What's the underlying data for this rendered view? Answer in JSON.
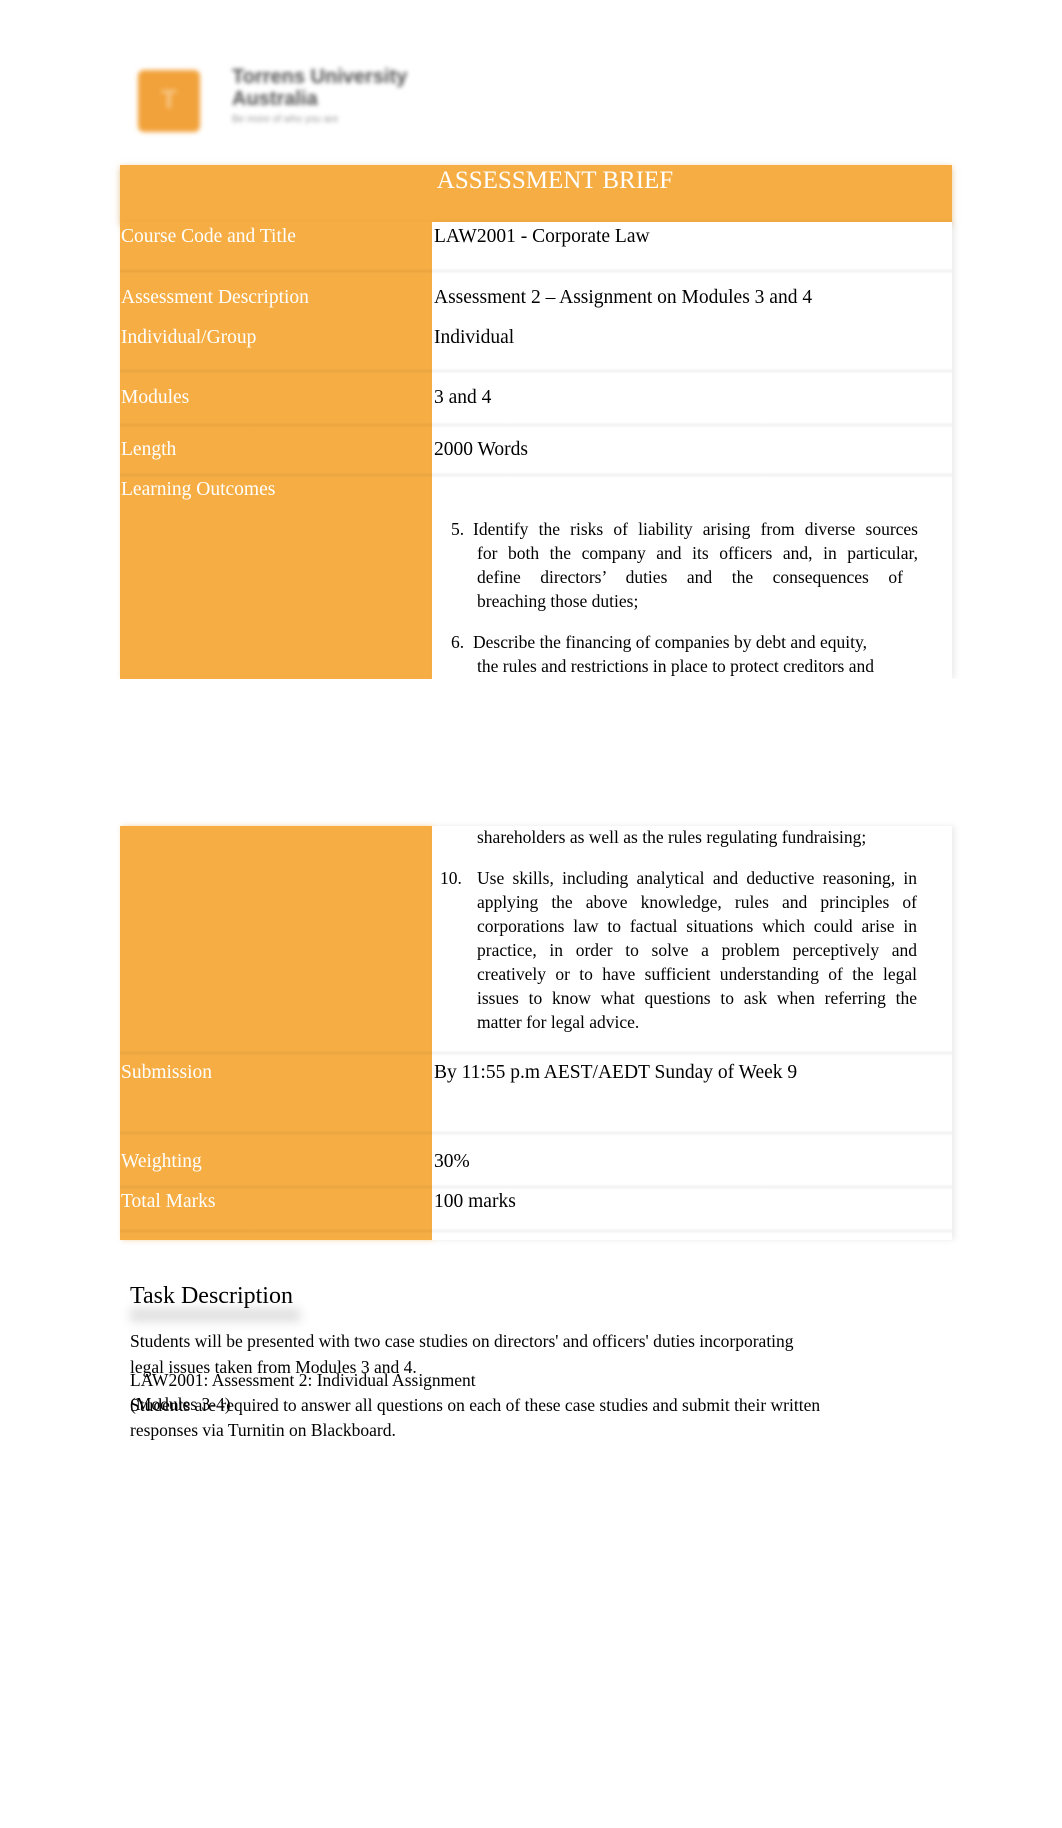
{
  "logo": {
    "name_line1": "Torrens University",
    "name_line2": "Australia",
    "tagline": "Be more of who you are",
    "mark_letter": "T"
  },
  "brief": {
    "title": "ASSESSMENT BRIEF",
    "accent_color": "#f6ae44",
    "rows": [
      {
        "label": "Course Code and Title",
        "value": "LAW2001 - Corporate Law"
      },
      {
        "label": "Assessment Description",
        "value": "Assessment 2 – Assignment on Modules 3 and 4"
      },
      {
        "label": "Individual/Group",
        "value": "Individual"
      },
      {
        "label": "Modules",
        "value": "3 and 4"
      },
      {
        "label": "Length",
        "value": "2000 Words"
      },
      {
        "label": "Learning Outcomes",
        "value": ""
      },
      {
        "label": "Submission",
        "value": "By 11:55 p.m AEST/AEDT Sunday of Week 9"
      },
      {
        "label": "Weighting",
        "value": "30%"
      },
      {
        "label": "Total Marks",
        "value": "100 marks"
      }
    ],
    "learning_outcomes": [
      {
        "number": "5.",
        "lines": [
          "Identify the risks of liability arising from diverse sources",
          "for both the company and its officers and, in particular,",
          "define directors’ duties and the consequences of",
          "breaching those duties;"
        ]
      },
      {
        "number": "6.",
        "lines": [
          "Describe the financing of companies by debt and equity,",
          "the rules and restrictions in place to protect creditors and",
          "shareholders as well as the rules regulating fundraising;"
        ]
      },
      {
        "number": "10.",
        "lines": [
          "Use skills, including analytical and deductive reasoning, in",
          "applying the above knowledge, rules and principles of",
          "corporations law to factual situations which could arise in",
          "practice, in order to solve a problem perceptively and",
          "creatively or to have sufficient understanding of the legal",
          "issues to know what questions to ask when referring the",
          "matter for legal advice."
        ]
      }
    ]
  },
  "task": {
    "heading": "Task Description",
    "paragraph1_line1": "Students will be presented with two case studies on directors' and officers' duties incorporating",
    "paragraph1_line2": "legal issues taken from Modules 3 and 4.",
    "paragraph2_line1": "Students are required   to answer all questions on each of these case studies and submit their written",
    "paragraph2_line2": "responses via Turnitin on Blackboard.",
    "overlay_header_line1": "LAW2001: Assessment 2: Individual Assignment",
    "overlay_header_line2": "(Modules 3-4)"
  }
}
